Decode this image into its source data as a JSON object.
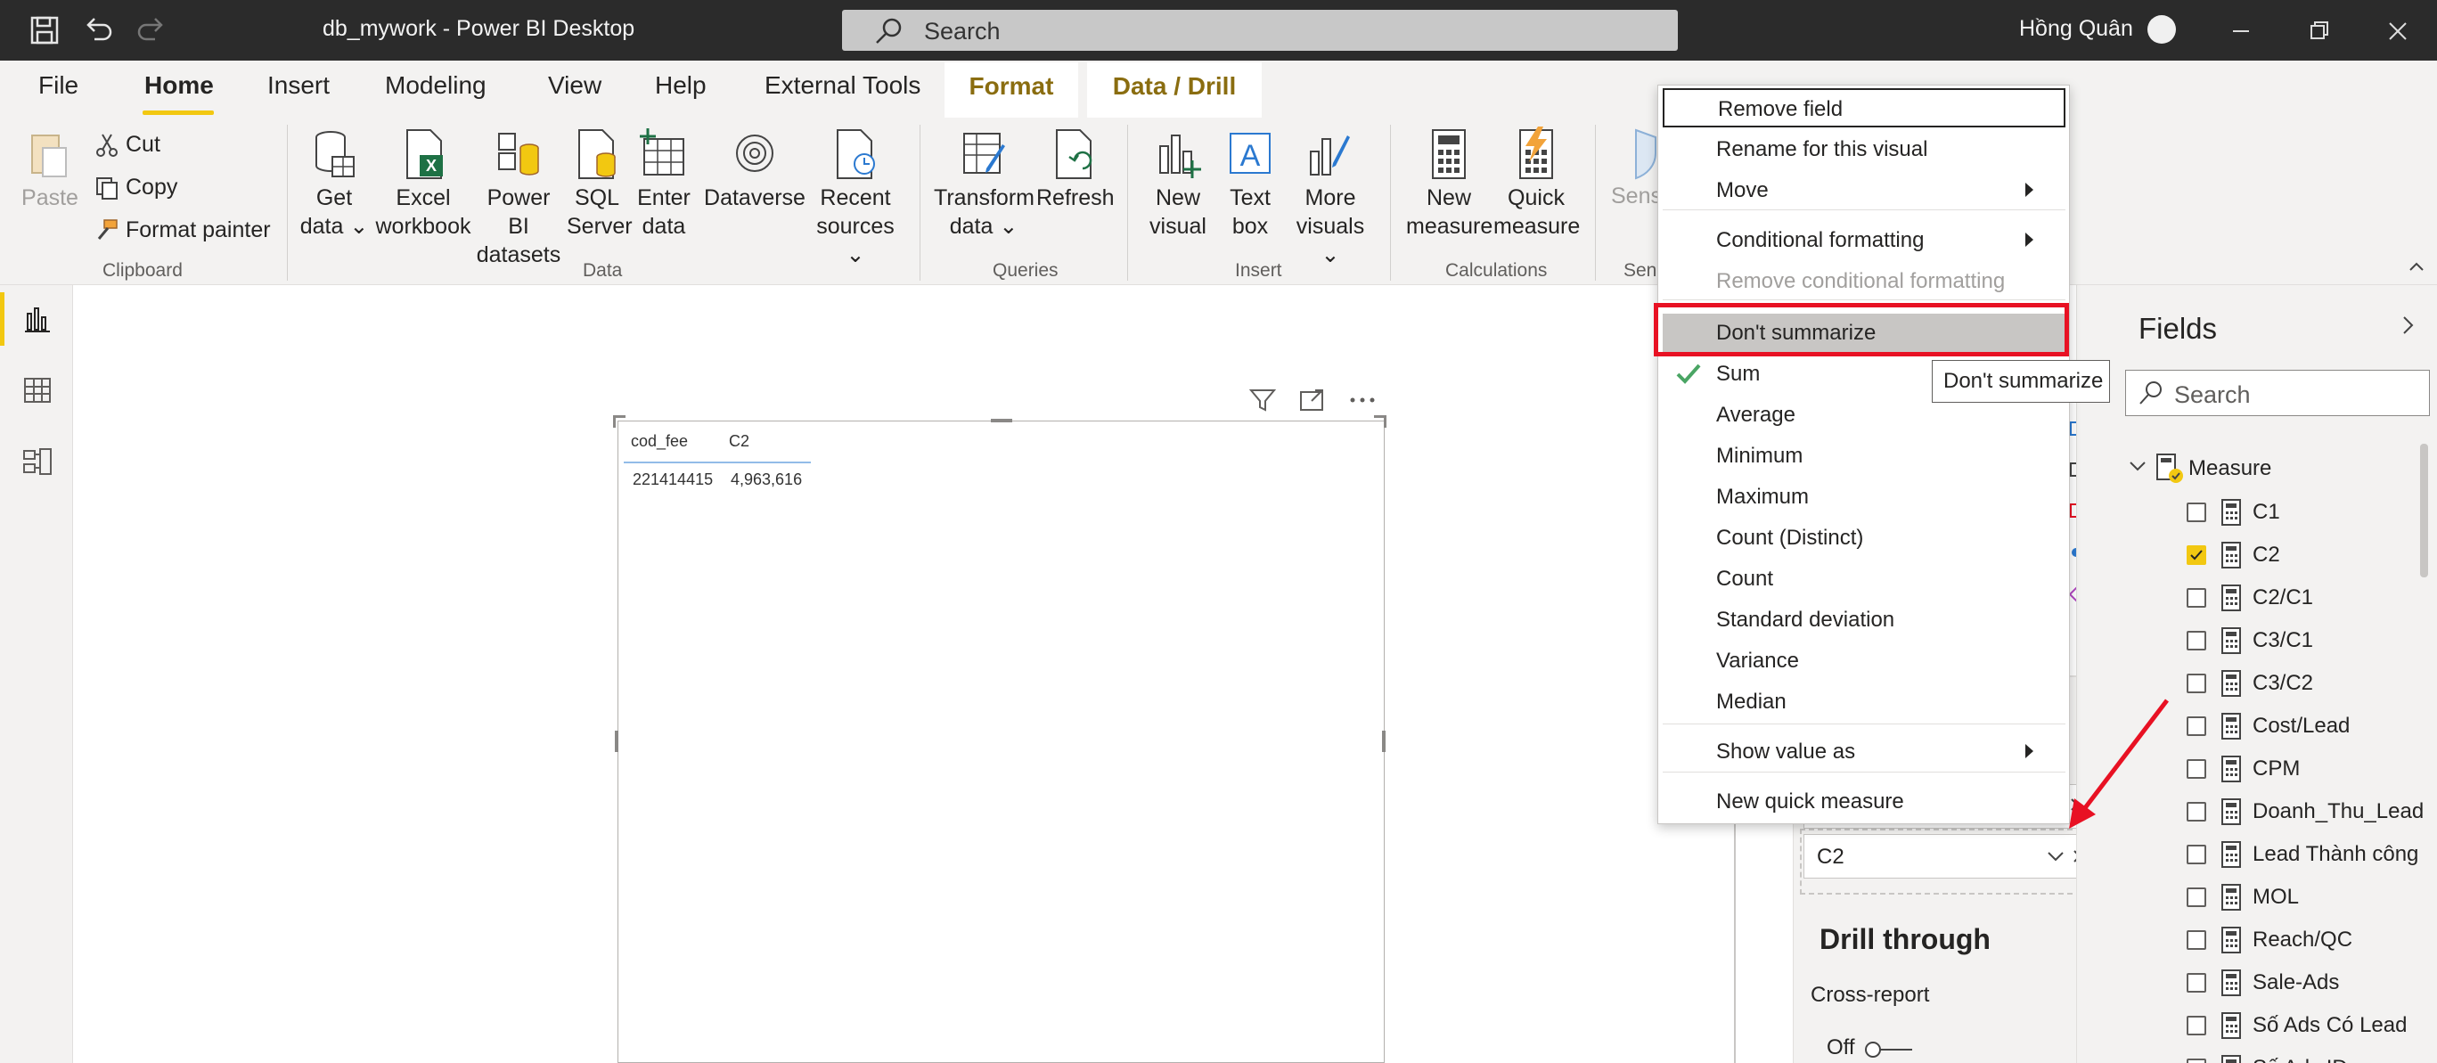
{
  "window": {
    "title": "db_mywork - Power BI Desktop",
    "search_placeholder": "Search",
    "user": "Hồng Quân"
  },
  "tabs": {
    "file": "File",
    "home": "Home",
    "insert": "Insert",
    "modeling": "Modeling",
    "view": "View",
    "help": "Help",
    "external_tools": "External Tools",
    "format": "Format",
    "data_drill": "Data / Drill"
  },
  "ribbon": {
    "clipboard": {
      "paste": "Paste",
      "cut": "Cut",
      "copy": "Copy",
      "format_painter": "Format painter",
      "label": "Clipboard"
    },
    "data": {
      "get_data": [
        "Get",
        "data"
      ],
      "excel": [
        "Excel",
        "workbook"
      ],
      "pbi_datasets": [
        "Power BI",
        "datasets"
      ],
      "sql": [
        "SQL",
        "Server"
      ],
      "enter": [
        "Enter",
        "data"
      ],
      "dataverse": "Dataverse",
      "recent": [
        "Recent",
        "sources"
      ],
      "label": "Data"
    },
    "queries": {
      "transform": [
        "Transform",
        "data"
      ],
      "refresh": "Refresh",
      "label": "Queries"
    },
    "insert": {
      "new_visual": [
        "New",
        "visual"
      ],
      "text_box": [
        "Text",
        "box"
      ],
      "more_visuals": [
        "More",
        "visuals"
      ],
      "label": "Insert"
    },
    "calculations": {
      "new_measure": [
        "New",
        "measure"
      ],
      "quick_measure": [
        "Quick",
        "measure"
      ],
      "label": "Calculations"
    },
    "sensitivity": {
      "btn": "Sens",
      "label": "Sens"
    }
  },
  "table_visual": {
    "headers": [
      "cod_fee",
      "C2"
    ],
    "row": [
      "221414415",
      "4,963,616"
    ]
  },
  "context_menu": {
    "items": [
      {
        "label": "Remove field",
        "disabled": false,
        "submenu": false
      },
      {
        "label": "Rename for this visual",
        "disabled": false,
        "submenu": false
      },
      {
        "label": "Move",
        "disabled": false,
        "submenu": true
      },
      {
        "label": "Conditional formatting",
        "disabled": false,
        "submenu": true
      },
      {
        "label": "Remove conditional formatting",
        "disabled": true,
        "submenu": false
      },
      {
        "label": "Don't summarize",
        "disabled": false,
        "submenu": false
      },
      {
        "label": "Sum",
        "disabled": false,
        "submenu": false,
        "checked": true
      },
      {
        "label": "Average"
      },
      {
        "label": "Minimum"
      },
      {
        "label": "Maximum"
      },
      {
        "label": "Count (Distinct)"
      },
      {
        "label": "Count"
      },
      {
        "label": "Standard deviation"
      },
      {
        "label": "Variance"
      },
      {
        "label": "Median"
      },
      {
        "label": "Show value as",
        "submenu": true
      },
      {
        "label": "New quick measure"
      }
    ],
    "tooltip": "Don't summarize"
  },
  "fields_pane": {
    "title": "Fields",
    "search_placeholder": "Search",
    "table_name": "Measure",
    "fields": [
      {
        "name": "C1",
        "checked": false
      },
      {
        "name": "C2",
        "checked": true
      },
      {
        "name": "C2/C1",
        "checked": false
      },
      {
        "name": "C3/C1",
        "checked": false
      },
      {
        "name": "C3/C2",
        "checked": false
      },
      {
        "name": "Cost/Lead",
        "checked": false
      },
      {
        "name": "CPM",
        "checked": false
      },
      {
        "name": "Doanh_Thu_Lead",
        "checked": false
      },
      {
        "name": "Lead Thành công",
        "checked": false
      },
      {
        "name": "MOL",
        "checked": false
      },
      {
        "name": "Reach/QC",
        "checked": false
      },
      {
        "name": "Sale-Ads",
        "checked": false
      },
      {
        "name": "Số Ads Có Lead",
        "checked": false
      },
      {
        "name": "Số Ads ID",
        "checked": false
      }
    ]
  },
  "viz_pane": {
    "well_value": "C2",
    "drill_title": "Drill through",
    "cross_report": "Cross-report",
    "toggle_state": "Off"
  },
  "colors": {
    "accent": "#f2c811",
    "highlight_box": "#e81123",
    "check": "#4aa564"
  }
}
